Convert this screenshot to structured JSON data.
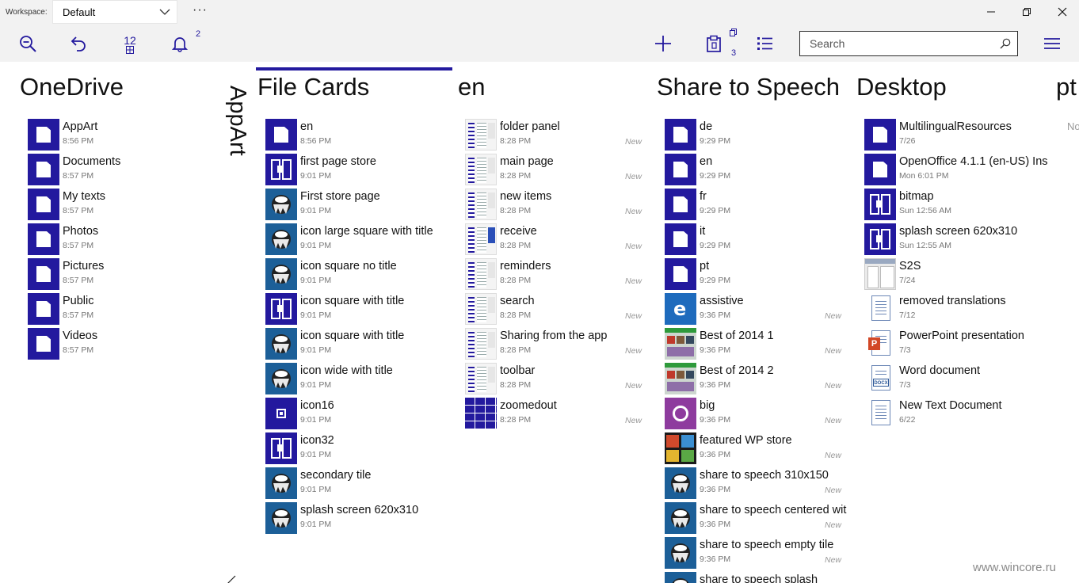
{
  "titlebar": {
    "workspace_label": "Workspace:",
    "workspace_value": "Default",
    "more": "···"
  },
  "toolbar": {
    "grid_count": "12",
    "notification_count": "2",
    "clipboard_count": "3",
    "search_placeholder": "Search",
    "accent_color": "#23199e"
  },
  "columns": [
    {
      "title": "OneDrive",
      "items": [
        {
          "name": "AppArt",
          "time": "8:56 PM",
          "icon": "folder-icon"
        },
        {
          "name": "Documents",
          "time": "8:57 PM",
          "icon": "folder-icon"
        },
        {
          "name": "My texts",
          "time": "8:57 PM",
          "icon": "folder-icon"
        },
        {
          "name": "Photos",
          "time": "8:57 PM",
          "icon": "folder-icon"
        },
        {
          "name": "Pictures",
          "time": "8:57 PM",
          "icon": "folder-icon"
        },
        {
          "name": "Public",
          "time": "8:57 PM",
          "icon": "folder-icon"
        },
        {
          "name": "Videos",
          "time": "8:57 PM",
          "icon": "folder-icon"
        }
      ]
    },
    {
      "title": "AppArt",
      "vertical": true,
      "items": []
    },
    {
      "title": "File Cards",
      "active": true,
      "items": [
        {
          "name": "en",
          "time": "8:56 PM",
          "icon": "folder-icon"
        },
        {
          "name": "first page store",
          "time": "9:01 PM",
          "icon": "book-icon"
        },
        {
          "name": "First store page",
          "time": "9:01 PM",
          "icon": "inkscape-icon"
        },
        {
          "name": "icon large square with title",
          "time": "9:01 PM",
          "icon": "inkscape-icon"
        },
        {
          "name": "icon square no title",
          "time": "9:01 PM",
          "icon": "inkscape-icon"
        },
        {
          "name": "icon square with title",
          "time": "9:01 PM",
          "icon": "book-icon"
        },
        {
          "name": "icon square with title",
          "time": "9:01 PM",
          "icon": "inkscape-icon"
        },
        {
          "name": "icon wide with title",
          "time": "9:01 PM",
          "icon": "inkscape-icon"
        },
        {
          "name": "icon16",
          "time": "9:01 PM",
          "icon": "small-square-icon"
        },
        {
          "name": "icon32",
          "time": "9:01 PM",
          "icon": "book-icon"
        },
        {
          "name": "secondary tile",
          "time": "9:01 PM",
          "icon": "inkscape-icon"
        },
        {
          "name": "splash screen 620x310",
          "time": "9:01 PM",
          "icon": "inkscape-icon"
        }
      ]
    },
    {
      "title": "en",
      "items": [
        {
          "name": "folder panel",
          "time": "8:28 PM",
          "new": "New",
          "icon": "screenshot-icon"
        },
        {
          "name": "main page",
          "time": "8:28 PM",
          "new": "New",
          "icon": "screenshot-icon"
        },
        {
          "name": "new items",
          "time": "8:28 PM",
          "new": "New",
          "icon": "screenshot-icon"
        },
        {
          "name": "receive",
          "time": "8:28 PM",
          "new": "New",
          "icon": "screenshot-blue-icon"
        },
        {
          "name": "reminders",
          "time": "8:28 PM",
          "new": "New",
          "icon": "screenshot-icon"
        },
        {
          "name": "search",
          "time": "8:28 PM",
          "new": "New",
          "icon": "screenshot-icon"
        },
        {
          "name": "Sharing from the app",
          "time": "8:28 PM",
          "new": "New",
          "icon": "screenshot-icon"
        },
        {
          "name": "toolbar",
          "time": "8:28 PM",
          "new": "New",
          "icon": "screenshot-icon"
        },
        {
          "name": "zoomedout",
          "time": "8:28 PM",
          "new": "New",
          "icon": "grid-icon"
        }
      ]
    },
    {
      "title": "Share to Speech",
      "items": [
        {
          "name": "de",
          "time": "9:29 PM",
          "icon": "folder-icon"
        },
        {
          "name": "en",
          "time": "9:29 PM",
          "icon": "folder-icon"
        },
        {
          "name": "fr",
          "time": "9:29 PM",
          "icon": "folder-icon"
        },
        {
          "name": "it",
          "time": "9:29 PM",
          "icon": "folder-icon"
        },
        {
          "name": "pt",
          "time": "9:29 PM",
          "icon": "folder-icon"
        },
        {
          "name": "assistive",
          "time": "9:36 PM",
          "new": "New",
          "icon": "ie-icon"
        },
        {
          "name": "Best of 2014 1",
          "time": "9:36 PM",
          "new": "New",
          "icon": "photo-icon"
        },
        {
          "name": "Best of 2014 2",
          "time": "9:36 PM",
          "new": "New",
          "icon": "photo-icon"
        },
        {
          "name": "big",
          "time": "9:36 PM",
          "new": "New",
          "icon": "big-icon"
        },
        {
          "name": "featured WP store",
          "time": "9:36 PM",
          "new": "New",
          "icon": "store-icon"
        },
        {
          "name": "share to speech 310x150",
          "time": "9:36 PM",
          "new": "New",
          "icon": "inkscape-icon"
        },
        {
          "name": "share to speech centered wit",
          "time": "9:36 PM",
          "new": "New",
          "icon": "inkscape-icon"
        },
        {
          "name": "share to speech empty tile",
          "time": "9:36 PM",
          "new": "New",
          "icon": "inkscape-icon"
        },
        {
          "name": "share to speech splash",
          "time": "",
          "new": "",
          "icon": "inkscape-icon"
        }
      ]
    },
    {
      "title": "Desktop",
      "items": [
        {
          "name": "MultilingualResources",
          "time": "7/26",
          "icon": "folder-icon"
        },
        {
          "name": "OpenOffice 4.1.1 (en-US) Ins",
          "time": "Mon 6:01 PM",
          "icon": "folder-icon"
        },
        {
          "name": "bitmap",
          "time": "Sun 12:56 AM",
          "icon": "book-icon"
        },
        {
          "name": "splash screen 620x310",
          "time": "Sun 12:55 AM",
          "icon": "book-icon"
        },
        {
          "name": "S2S",
          "time": "7/24",
          "icon": "s2s-icon"
        },
        {
          "name": "removed translations",
          "time": "7/12",
          "icon": "text-document-icon"
        },
        {
          "name": "PowerPoint presentation",
          "time": "7/3",
          "icon": "powerpoint-icon"
        },
        {
          "name": "Word document",
          "time": "7/3",
          "icon": "word-icon"
        },
        {
          "name": "New Text Document",
          "time": "6/22",
          "icon": "text-document-icon"
        }
      ]
    },
    {
      "title": "pt",
      "note": "No",
      "items": []
    }
  ],
  "watermark": "www.wincore.ru"
}
